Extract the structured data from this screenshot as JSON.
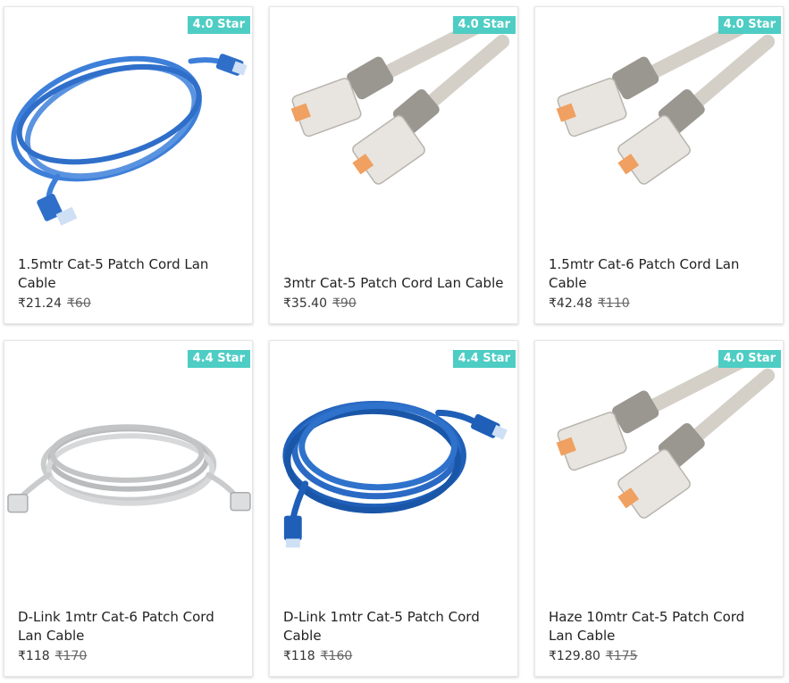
{
  "products": [
    {
      "rating": "4.0 Star",
      "title": "1.5mtr Cat-5 Patch Cord Lan Cable",
      "price": "₹21.24",
      "mrp": "₹60"
    },
    {
      "rating": "4.0 Star",
      "title": "3mtr Cat-5 Patch Cord Lan Cable",
      "price": "₹35.40",
      "mrp": "₹90"
    },
    {
      "rating": "4.0 Star",
      "title": "1.5mtr Cat-6 Patch Cord Lan Cable",
      "price": "₹42.48",
      "mrp": "₹110"
    },
    {
      "rating": "4.4 Star",
      "title": "D-Link 1mtr Cat-6 Patch Cord Lan Cable",
      "price": "₹118",
      "mrp": "₹170"
    },
    {
      "rating": "4.4 Star",
      "title": "D-Link 1mtr Cat-5 Patch Cord Cable",
      "price": "₹118",
      "mrp": "₹160"
    },
    {
      "rating": "4.0 Star",
      "title": "Haze 10mtr Cat-5 Patch Cord Lan Cable",
      "price": "₹129.80",
      "mrp": "₹175"
    }
  ],
  "colors": {
    "badge": "#4ecdc4",
    "blue_cable": "#3d7fd9",
    "grey_cable": "#d4d0c8",
    "light_grey_cable": "#c9cbcc"
  },
  "images": [
    "blue-coiled-cable-image",
    "beige-cable-connectors-image",
    "beige-cable-connectors-image",
    "grey-coiled-cable-image",
    "blue-coiled-cable-image",
    "beige-cable-connectors-image"
  ]
}
